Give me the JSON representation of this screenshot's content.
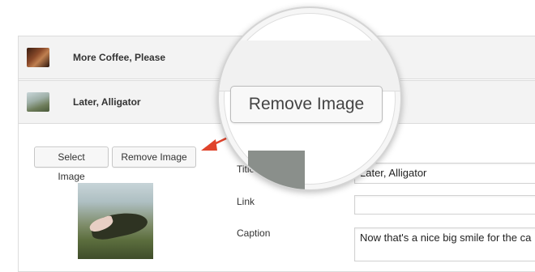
{
  "rows": [
    {
      "title": "More Coffee, Please"
    },
    {
      "title": "Later, Alligator"
    }
  ],
  "buttons": {
    "select_image": "Select Image",
    "remove_image": "Remove Image"
  },
  "magnifier": {
    "label": "Remove Image"
  },
  "fields": {
    "title_label": "Title",
    "title_value": "Later, Alligator",
    "link_label": "Link",
    "link_value": "",
    "caption_label": "Caption",
    "caption_value": "Now that's a nice big smile for the ca"
  },
  "colors": {
    "arrow": "#e0442c"
  }
}
